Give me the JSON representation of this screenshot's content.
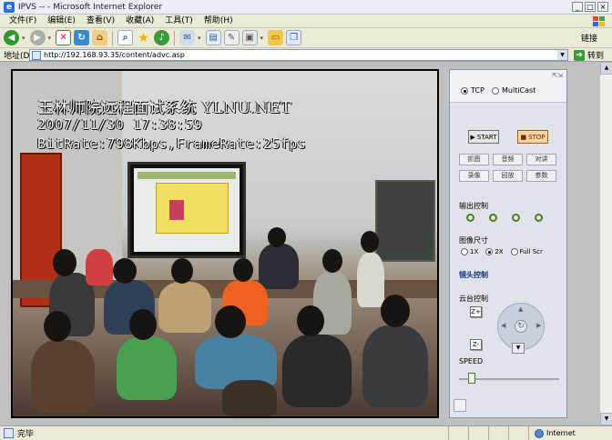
{
  "window": {
    "title": "IPVS -- - Microsoft Internet Explorer",
    "controls": {
      "minimize": "_",
      "maximize": "□",
      "close": "×"
    }
  },
  "menu": [
    "文件(F)",
    "编辑(E)",
    "查看(V)",
    "收藏(A)",
    "工具(T)",
    "帮助(H)"
  ],
  "toolbar": {
    "links_label": "链接"
  },
  "address": {
    "label": "地址(D)",
    "url": "http://192.168.93.35/content/advc.asp",
    "go_label": "转到"
  },
  "video": {
    "overlay_line1": "玉林师院远程面试系统 YLNU.NET",
    "overlay_line2": "2007/11/30 17:38:59",
    "overlay_line3": "BitRate:798Kbps,FrameRate:25fps"
  },
  "panel": {
    "protocol": {
      "tcp_label": "TCP",
      "multicast_label": "MultiCast",
      "selected": "TCP"
    },
    "start_label": "START",
    "stop_label": "STOP",
    "buttons": [
      "抓图",
      "音频",
      "对讲",
      "录像",
      "回放",
      "参数"
    ],
    "output_label": "输出控制",
    "size_label": "图像尺寸",
    "size_options": [
      "1X",
      "2X",
      "Full Scr"
    ],
    "size_selected": "2X",
    "lens_label": "镜头控制",
    "ptz_label": "云台控制",
    "zoom_in": "Z+",
    "zoom_out": "Z-",
    "speed_label": "SPEED",
    "speed_value": 0.1
  },
  "status": {
    "text": "完毕",
    "zone": "Internet"
  },
  "colors": {
    "stop_button": "#f4d4a0",
    "indicator": "#4c7a2a",
    "lens_label": "#1a3a80"
  }
}
